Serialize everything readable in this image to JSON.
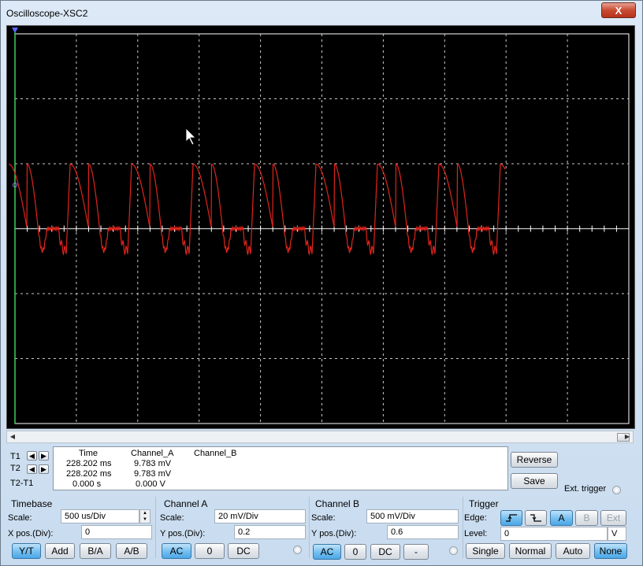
{
  "window": {
    "title": "Oscilloscope-XSC2",
    "close_label": "X"
  },
  "readout": {
    "headers": {
      "time": "Time",
      "channel_a": "Channel_A",
      "channel_b": "Channel_B"
    },
    "rows": [
      {
        "label": "T1",
        "time": "228.202 ms",
        "channel_a": "9.783 mV",
        "channel_b": ""
      },
      {
        "label": "T2",
        "time": "228.202 ms",
        "channel_a": "9.783 mV",
        "channel_b": ""
      },
      {
        "label": "T2-T1",
        "time": "0.000 s",
        "channel_a": "0.000 V",
        "channel_b": ""
      }
    ],
    "reverse_label": "Reverse",
    "save_label": "Save",
    "ext_trigger_label": "Ext. trigger"
  },
  "timebase": {
    "title": "Timebase",
    "scale_label": "Scale:",
    "scale_value": "500 us/Div",
    "xpos_label": "X pos.(Div):",
    "xpos_value": "0",
    "buttons": [
      "Y/T",
      "Add",
      "B/A",
      "A/B"
    ],
    "active": "Y/T"
  },
  "channel_a": {
    "title": "Channel A",
    "scale_label": "Scale:",
    "scale_value": "20 mV/Div",
    "ypos_label": "Y pos.(Div):",
    "ypos_value": "0.2",
    "buttons": [
      "AC",
      "0",
      "DC"
    ],
    "active": "AC"
  },
  "channel_b": {
    "title": "Channel B",
    "scale_label": "Scale:",
    "scale_value": "500 mV/Div",
    "ypos_label": "Y pos.(Div):",
    "ypos_value": "0.6",
    "buttons": [
      "AC",
      "0",
      "DC",
      "-"
    ],
    "active": "AC"
  },
  "trigger": {
    "title": "Trigger",
    "edge_label": "Edge:",
    "edge_rising": "rising-edge-icon",
    "edge_falling": "falling-edge-icon",
    "sources": [
      "A",
      "B",
      "Ext"
    ],
    "level_label": "Level:",
    "level_value": "0",
    "level_unit": "V",
    "modes": [
      "Single",
      "Normal",
      "Auto",
      "None"
    ],
    "active_mode": "None",
    "active_source": "A"
  },
  "colors": {
    "trace": "#e0241c",
    "grid": "#c8c8c8",
    "cursor": "#3fd05a",
    "screen": "#000000"
  }
}
